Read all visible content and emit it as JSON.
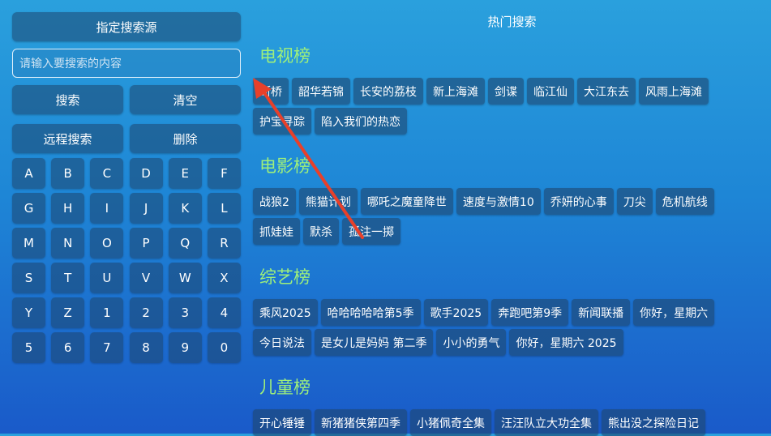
{
  "left_panel": {
    "source_button": "指定搜索源",
    "search_placeholder": "请输入要搜索的内容",
    "search_button": "搜索",
    "clear_button": "清空",
    "remote_search_button": "远程搜索",
    "delete_button": "删除",
    "keys": [
      "A",
      "B",
      "C",
      "D",
      "E",
      "F",
      "G",
      "H",
      "I",
      "J",
      "K",
      "L",
      "M",
      "N",
      "O",
      "P",
      "Q",
      "R",
      "S",
      "T",
      "U",
      "V",
      "W",
      "X",
      "Y",
      "Z",
      "1",
      "2",
      "3",
      "4",
      "5",
      "6",
      "7",
      "8",
      "9",
      "0"
    ]
  },
  "right_panel": {
    "title": "热门搜索",
    "sections": [
      {
        "title": "电视榜",
        "items": [
          "断桥",
          "韶华若锦",
          "长安的荔枝",
          "新上海滩",
          "剑谍",
          "临江仙",
          "大江东去",
          "风雨上海滩",
          "护宝寻踪",
          "陷入我们的热恋"
        ]
      },
      {
        "title": "电影榜",
        "items": [
          "战狼2",
          "熊猫计划",
          "哪吒之魔童降世",
          "速度与激情10",
          "乔妍的心事",
          "刀尖",
          "危机航线",
          "抓娃娃",
          "默杀",
          "孤注一掷"
        ]
      },
      {
        "title": "综艺榜",
        "items": [
          "乘风2025",
          "哈哈哈哈哈第5季",
          "歌手2025",
          "奔跑吧第9季",
          "新闻联播",
          "你好，星期六",
          "今日说法",
          "是女儿是妈妈 第二季",
          "小小的勇气",
          "你好，星期六 2025"
        ]
      },
      {
        "title": "儿童榜",
        "items": [
          "开心锤锤",
          "新猪猪侠第四季",
          "小猪佩奇全集",
          "汪汪队立大功全集",
          "熊出没之探险日记"
        ]
      }
    ]
  },
  "colors": {
    "section_title": "#9ff07a",
    "arrow": "#e8402a"
  }
}
